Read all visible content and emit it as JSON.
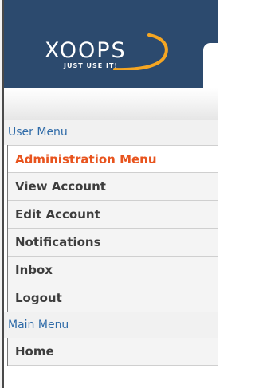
{
  "header": {
    "logo_text": "XOOPS",
    "logo_tagline": "JUST USE IT!"
  },
  "menus": {
    "user_menu": {
      "title": "User Menu",
      "items": [
        {
          "label": "Administration Menu",
          "active": true
        },
        {
          "label": "View Account"
        },
        {
          "label": "Edit Account"
        },
        {
          "label": "Notifications"
        },
        {
          "label": "Inbox"
        },
        {
          "label": "Logout"
        }
      ]
    },
    "main_menu": {
      "title": "Main Menu",
      "items": [
        {
          "label": "Home"
        }
      ]
    }
  },
  "colors": {
    "header_bg": "#2c4a6e",
    "menu_title": "#2f6ba8",
    "active_item": "#e8541e",
    "item_text": "#3d3d3d"
  },
  "icons": {
    "logo": "xoops-logo-icon",
    "swoosh": "swoosh-icon"
  }
}
